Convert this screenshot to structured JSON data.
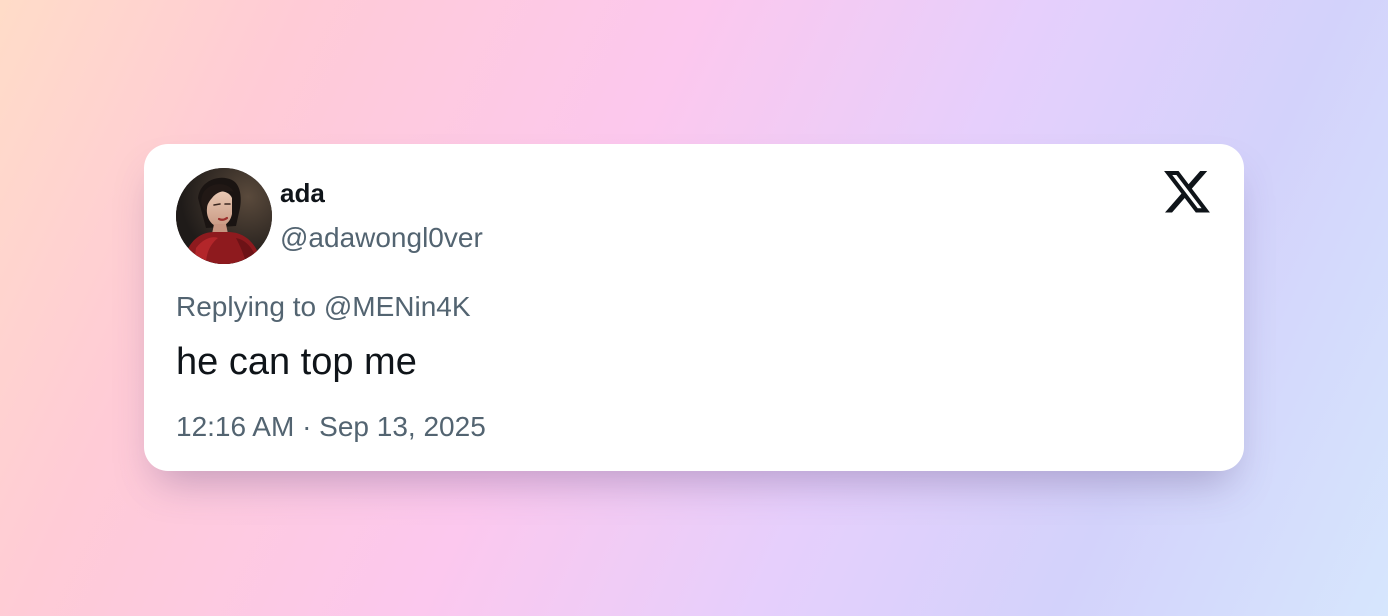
{
  "tweet": {
    "author": {
      "display_name": "ada",
      "handle": "@adawongl0ver",
      "avatar_icon": "profile-avatar"
    },
    "platform_icon": "x-logo-icon",
    "replying_to": "Replying to @MENin4K",
    "text": "he can top me",
    "timestamp": "12:16 AM · Sep 13, 2025"
  },
  "colors": {
    "card_background": "#ffffff",
    "primary_text": "#0f1419",
    "secondary_text": "#536471"
  }
}
